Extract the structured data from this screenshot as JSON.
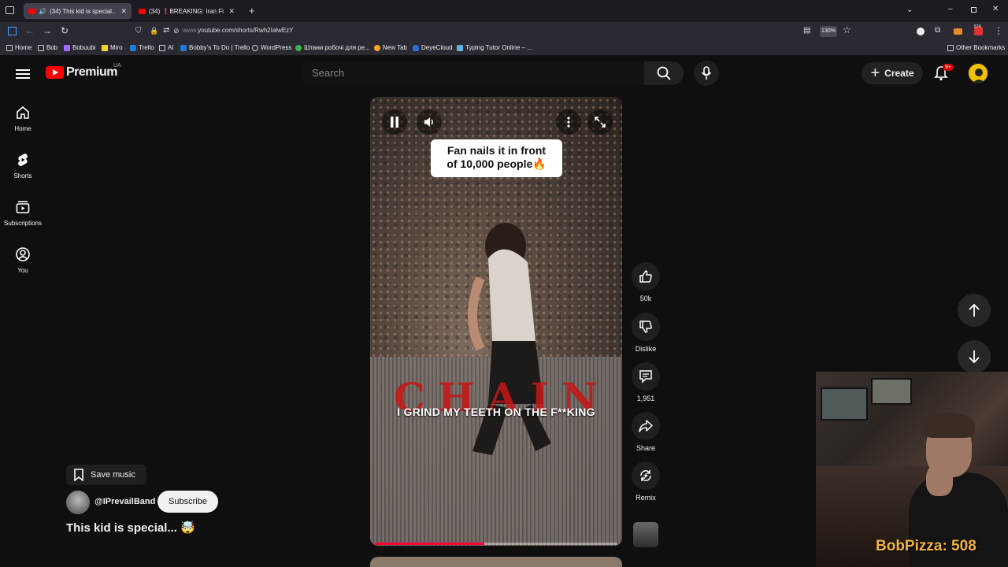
{
  "browser": {
    "tabs": [
      {
        "label": "(34) This kid is special... 🤯",
        "active": true
      },
      {
        "label": "(34) ❗BREAKING: Iran Fire Mi...",
        "active": false
      }
    ],
    "url_prefix": "www.",
    "url": "youtube.com/shorts/Rwh2IalwEzY",
    "zoom": "130%",
    "ext_badge": "574",
    "bookmarks": [
      "Home",
      "Bob",
      "Bobuubi",
      "Miro",
      "Trello",
      "AI",
      "Bobby's To Do | Trello",
      "WordPress",
      "Штани робочі для ре...",
      "New Tab",
      "DeyeCloud",
      "Typing Tutor Online – ..."
    ],
    "other_bookmarks": "Other Bookmarks"
  },
  "header": {
    "logo_text": "Premium",
    "country_code": "UA",
    "search_placeholder": "Search",
    "create_label": "Create",
    "notification_count": "9+"
  },
  "sidebar": {
    "items": [
      {
        "label": "Home",
        "icon": "home-icon"
      },
      {
        "label": "Shorts",
        "icon": "shorts-icon"
      },
      {
        "label": "Subscriptions",
        "icon": "subscriptions-icon"
      },
      {
        "label": "You",
        "icon": "you-icon"
      }
    ]
  },
  "short": {
    "overlay_text_line1": "Fan nails it in front",
    "overlay_text_line2": "of 10,000 people🔥",
    "video_word": "CHAIN",
    "lyric": "I GRIND MY TEETH ON THE F**KING",
    "progress": 0.45,
    "title": "This kid is special... 🤯",
    "channel": "@IPrevailBand",
    "subscribe_label": "Subscribe",
    "save_music_label": "Save music"
  },
  "actions": {
    "like_count": "50k",
    "dislike_label": "Dislike",
    "comment_count": "1,951",
    "share_label": "Share",
    "remix_label": "Remix"
  },
  "stream": {
    "overlay_label": "BobPizza: 508"
  },
  "colors": {
    "brand_red": "#ff0000",
    "background": "#0f0f0f",
    "overlay_gold": "#f2b33c"
  }
}
